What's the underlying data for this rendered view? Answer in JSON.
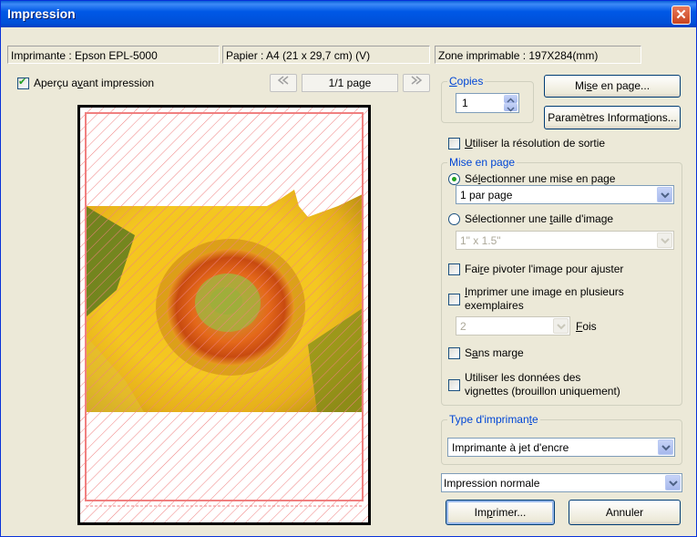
{
  "title": "Impression",
  "info": {
    "printer": "Imprimante : Epson EPL-5000",
    "paper": "Papier : A4 (21 x 29,7 cm) (V)",
    "printable_zone": "Zone imprimable : 197X284(mm)"
  },
  "preview": {
    "checkbox_label_pre": "Aperçu a",
    "checkbox_label_u": "v",
    "checkbox_label_post": "ant impression",
    "checked": true,
    "page_indicator": "1/1 page",
    "prev_icon": "double-left-arrow-icon",
    "next_icon": "double-right-arrow-icon"
  },
  "copies": {
    "legend_u": "C",
    "legend_rest": "opies",
    "value": "1"
  },
  "buttons": {
    "page_setup_pre": "Mi",
    "page_setup_u": "s",
    "page_setup_post": "e en page...",
    "params_pre": "Paramètres Informa",
    "params_u": "t",
    "params_post": "ions...",
    "print_pre": "Im",
    "print_u": "p",
    "print_post": "rimer...",
    "cancel": "Annuler"
  },
  "output_resolution": {
    "label_u": "U",
    "label_rest": "tiliser la résolution de sortie",
    "checked": false
  },
  "layout": {
    "legend": "Mise en page",
    "select_layout_pre": "Sé",
    "select_layout_u": "l",
    "select_layout_post": "ectionner une mise en page",
    "layout_value": "1 par page",
    "select_size_pre": "Sélectionner une ",
    "select_size_u": "t",
    "select_size_post": "aille d'image",
    "size_value": "1\" x 1.5\"",
    "rotate_pre": "Fai",
    "rotate_u": "r",
    "rotate_post": "e pivoter l'image pour ajuster",
    "multi_u": "I",
    "multi_line1_rest": "mprimer une image en plusieurs",
    "multi_line2": "exemplaires",
    "times_value": "2",
    "times_u": "F",
    "times_rest": "ois",
    "borderless_pre": "S",
    "borderless_u": "a",
    "borderless_post": "ns marge",
    "thumbs_line1": "Utiliser les données des",
    "thumbs_line2_pre": "vi",
    "thumbs_line2_u": "g",
    "thumbs_line2_post": "nettes (brouillon uniquement)"
  },
  "printer_type": {
    "legend_pre": "Type d'impriman",
    "legend_u": "t",
    "legend_post": "e",
    "value": "Imprimante à jet d'encre"
  },
  "print_quality": {
    "value": "Impression normale"
  },
  "colors": {
    "title_bar": "#0058e6",
    "legend": "#0046d5",
    "preview_hatch": "#f08080"
  }
}
